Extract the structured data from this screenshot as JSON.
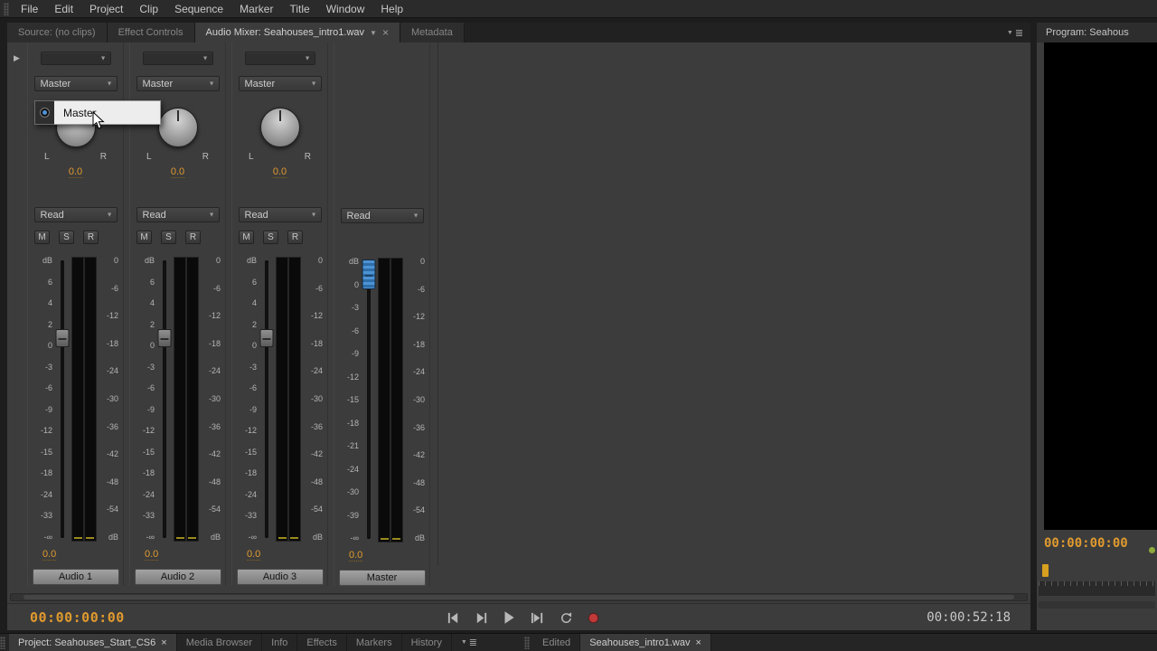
{
  "icons": {
    "chevron_down": "▼",
    "close": "×",
    "panel_menu": "≣",
    "expand_arrow": "▶"
  },
  "menu_bar": {
    "items": [
      "File",
      "Edit",
      "Project",
      "Clip",
      "Sequence",
      "Marker",
      "Title",
      "Window",
      "Help"
    ]
  },
  "mixer_panel": {
    "tabs": {
      "source": "Source: (no clips)",
      "effect_controls": "Effect Controls",
      "audio_mixer": "Audio Mixer: Seahouses_intro1.wav",
      "metadata": "Metadata"
    },
    "db_label": "dB",
    "db_label_bottom": "dB",
    "pan_left_label": "L",
    "pan_right_label": "R",
    "msr_buttons": [
      "M",
      "S",
      "R"
    ],
    "audio_fader_scale": [
      "6",
      "4",
      "2",
      "0",
      "-3",
      "-6",
      "-9",
      "-12",
      "-15",
      "-18",
      "-24",
      "-33",
      "-∞"
    ],
    "master_fader_scale": [
      "0",
      "-3",
      "-6",
      "-9",
      "-12",
      "-15",
      "-18",
      "-21",
      "-24",
      "-30",
      "-39",
      "-∞"
    ],
    "meter_scale": [
      "0",
      "-6",
      "-12",
      "-18",
      "-24",
      "-30",
      "-36",
      "-42",
      "-48",
      "-54",
      "dB"
    ],
    "channels": [
      {
        "name": "Audio 1",
        "output": "Master",
        "automation": "Read",
        "pan": "0.0",
        "level": "0.0"
      },
      {
        "name": "Audio 2",
        "output": "Master",
        "automation": "Read",
        "pan": "0.0",
        "level": "0.0"
      },
      {
        "name": "Audio 3",
        "output": "Master",
        "automation": "Read",
        "pan": "0.0",
        "level": "0.0"
      },
      {
        "name": "Master",
        "automation": "Read",
        "level": "0.0"
      }
    ],
    "output_popup": {
      "selected_item": "Master"
    },
    "playhead_timecode": "00:00:00:00",
    "duration_timecode": "00:00:52:18"
  },
  "program_panel": {
    "title": "Program: Seahous",
    "timecode": "00:00:00:00"
  },
  "bottom_bar": {
    "project_tab": "Project: Seahouses_Start_CS6",
    "tabs": [
      "Media Browser",
      "Info",
      "Effects",
      "Markers",
      "History"
    ],
    "edited_tab": "Edited",
    "wav_tab": "Seahouses_intro1.wav"
  },
  "colors": {
    "timecode_orange": "#e09a2e",
    "master_fader_blue": "#3f88c5",
    "record_red": "#c03a3a",
    "popup_highlight": "#ededed"
  }
}
